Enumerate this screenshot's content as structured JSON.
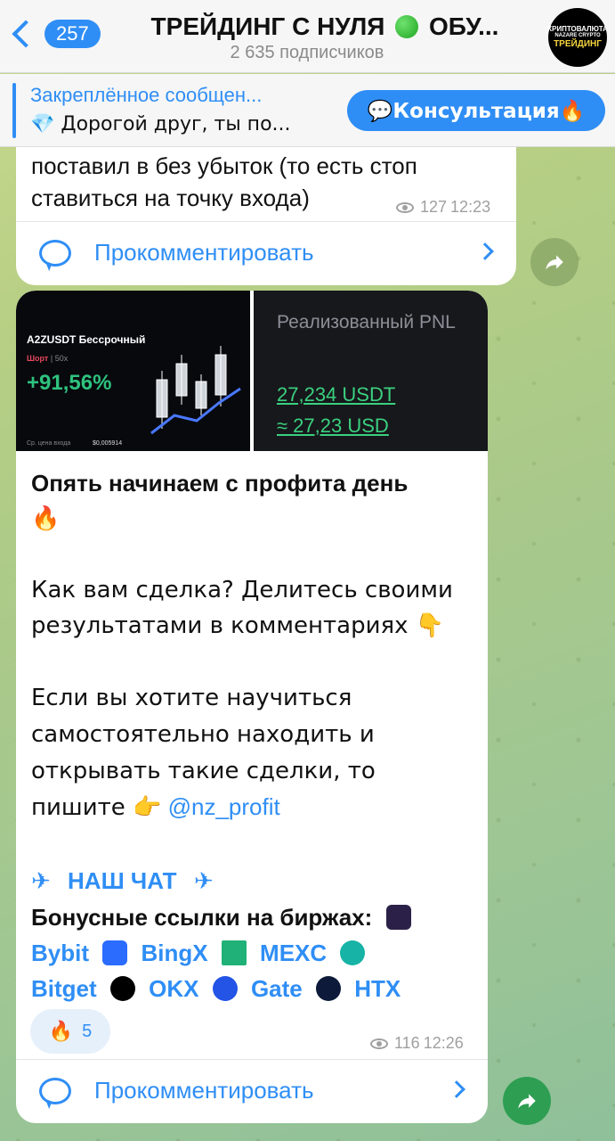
{
  "header": {
    "back_count": "257",
    "title_part1": "ТРЕЙДИНГ С НУЛЯ",
    "title_part2": "ОБУ...",
    "subtitle": "2 635 подписчиков",
    "avatar_line1": "КРИПТОВАЛЮТА",
    "avatar_line2": "NAZARE CRYPTO",
    "avatar_line3": "ТРЕЙДИНГ"
  },
  "pinned": {
    "title": "Закреплённое сообщен...",
    "text": "💎 Дорогой друг, ты по...",
    "button_label": "💬Консультация🔥"
  },
  "message1": {
    "text_line1": "поставил в без убыток (то есть стоп",
    "text_line2": "ставиться на точку входа)",
    "views": "127",
    "time": "12:23",
    "comment_label": "Прокомментировать"
  },
  "message2": {
    "photo1": {
      "pair": "A2ZUSDT Бессрочный",
      "side": "Шорт",
      "leverage": "50x",
      "percent": "+91,56%",
      "footer_label": "Ср. цена входа",
      "footer_value": "$0,005914"
    },
    "photo2": {
      "title": "Реализованный PNL",
      "usdt": "27,234 USDT",
      "usd": "≈ 27,23 USD"
    },
    "headline": "Опять начинаем с профита день",
    "headline_emoji": "🔥",
    "para1": "Как вам сделка? Делитесь своими результатами в комментариях 👇",
    "para2_text": "Если вы хотите научиться самостоятельно находить и открывать такие сделки, то пишите 👉",
    "para2_link": "@nz_profit",
    "chat_label": "НАШ ЧАТ",
    "bonus_label": "Бонусные ссылки на биржах:",
    "exchanges_row1": [
      "Bybit",
      "BingX",
      "MEXC"
    ],
    "exchanges_row2": [
      "Bitget",
      "OKX",
      "Gate",
      "HTX"
    ],
    "reaction_emoji": "🔥",
    "reaction_count": "5",
    "views": "116",
    "time": "12:26",
    "comment_label": "Прокомментировать"
  },
  "colors": {
    "accent": "#2f8ef5",
    "profit_green": "#2ec27e",
    "share_button": "#2e9e52"
  }
}
